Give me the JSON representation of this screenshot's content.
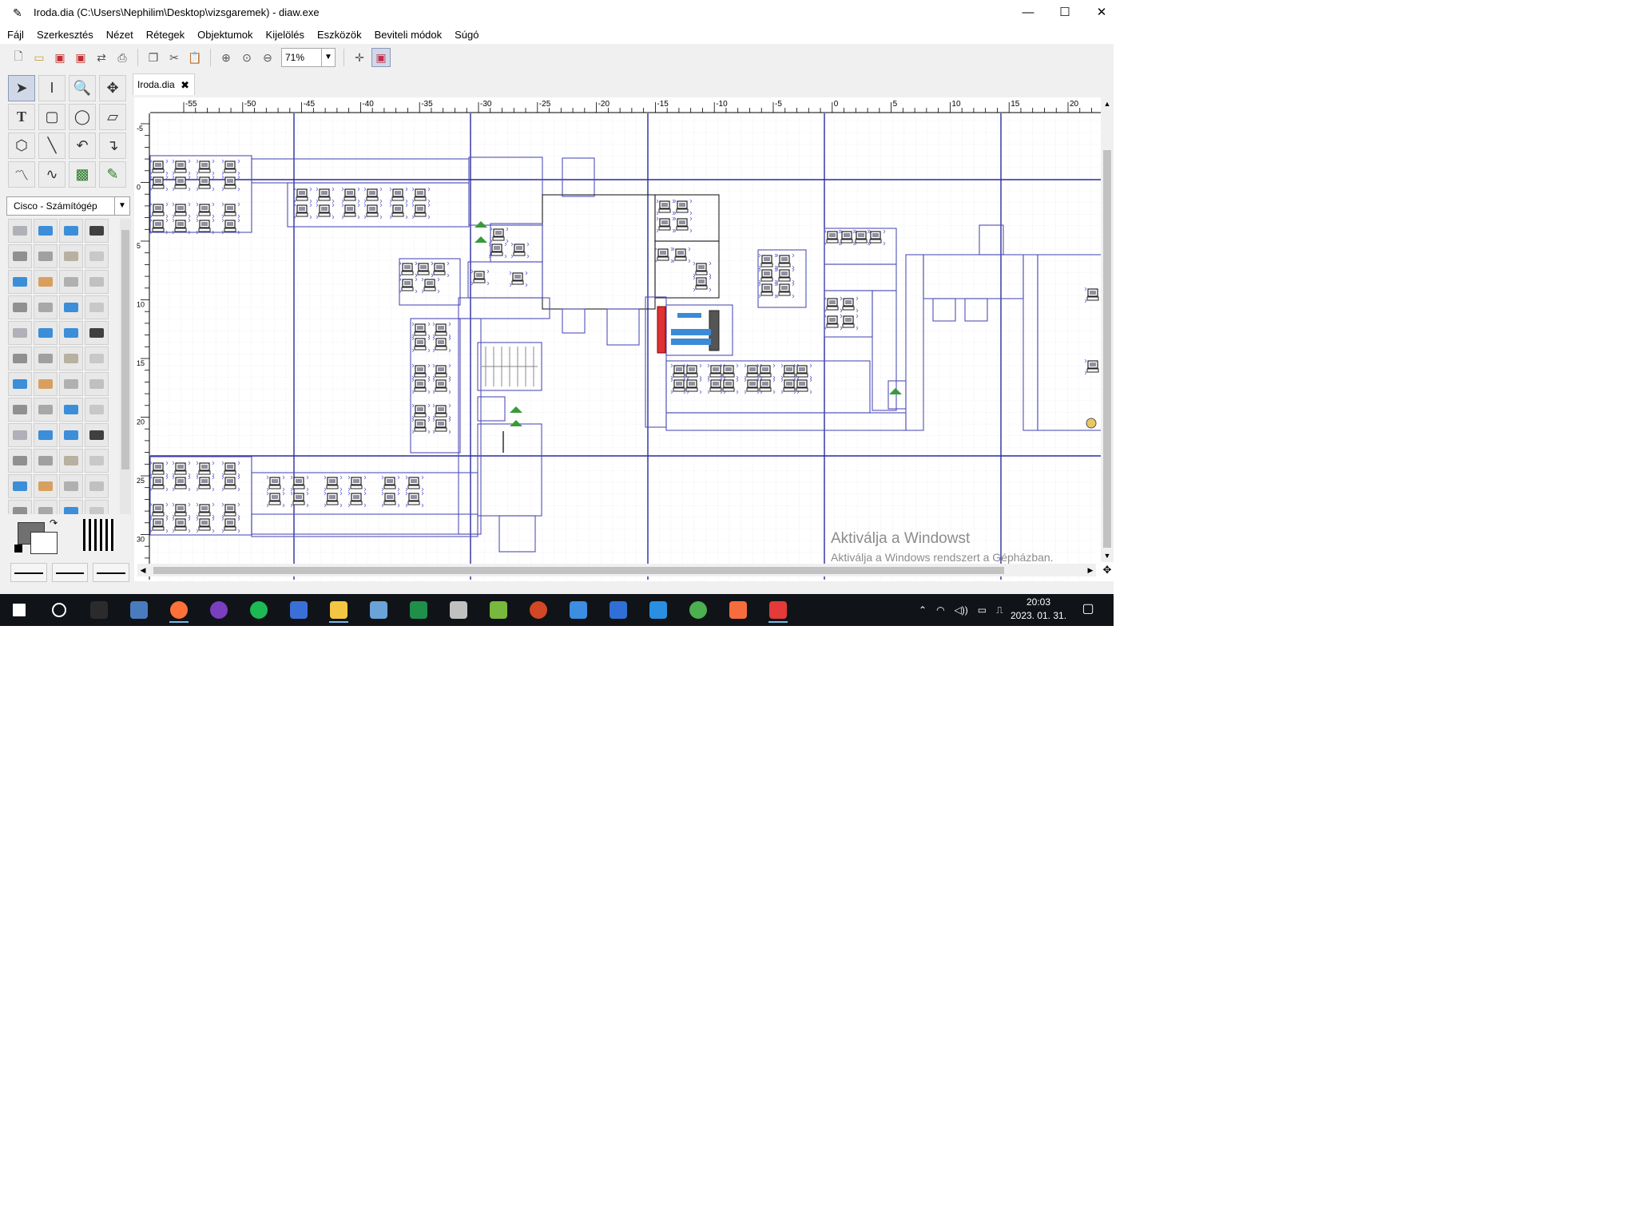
{
  "window": {
    "title": "Iroda.dia (C:\\Users\\Nephilim\\Desktop\\vizsgaremek) - diaw.exe",
    "minimize": "—",
    "maximize": "☐",
    "close": "✕"
  },
  "menu": [
    "Fájl",
    "Szerkesztés",
    "Nézet",
    "Rétegek",
    "Objektumok",
    "Kijelölés",
    "Eszközök",
    "Beviteli módok",
    "Súgó"
  ],
  "toolbar": {
    "zoom_value": "71%",
    "icons": [
      "new-icon",
      "open-icon",
      "save-icon",
      "save-as-icon",
      "export-icon",
      "print-icon",
      "copy-icon",
      "cut-icon",
      "paste-icon",
      "zoom-in-icon",
      "zoom-fit-icon",
      "zoom-out-icon"
    ]
  },
  "toolbox": {
    "sheet_name": "Cisco - Számítógép"
  },
  "document": {
    "tab_label": "Iroda.dia",
    "tab_close": "✖"
  },
  "rulers": {
    "horizontal": [
      "-55",
      "-50",
      "-45",
      "-40",
      "-35",
      "-30",
      "-25",
      "-20",
      "-15",
      "-10",
      "-5",
      "0",
      "5",
      "10",
      "15",
      "20"
    ],
    "vertical": [
      "-5",
      "0",
      "5",
      "10",
      "15",
      "20",
      "25",
      "30"
    ]
  },
  "watermark": {
    "line1": "Aktiválja a Windowst",
    "line2": "Aktiválja a Windows rendszert a Gépházban."
  },
  "taskbar": {
    "clock_time": "20:03",
    "clock_date": "2023. 01. 31.",
    "apps": [
      "start-icon",
      "search-icon",
      "terminal-icon",
      "calculator-icon",
      "firefox-icon",
      "tor-icon",
      "spotify-icon",
      "save-disk-icon",
      "file-explorer-icon",
      "paint-icon",
      "excel-icon",
      "pen-icon",
      "utorrent-icon",
      "powerpoint-icon",
      "edge-icon",
      "shark-icon",
      "vscode-icon",
      "chrome-icon",
      "xampp-icon",
      "dia-icon"
    ],
    "colors": [
      "#ffffff",
      "#ffffff",
      "#2b2b2b",
      "#4a7bbf",
      "#ff7139",
      "#7a3fbf",
      "#1db954",
      "#3a6fd8",
      "#f4c542",
      "#6aa3d8",
      "#1f8f4a",
      "#c0c0c0",
      "#78b83c",
      "#d24726",
      "#3d8de0",
      "#2f6fd6",
      "#2a8fe0",
      "#4caf50",
      "#f76c3c",
      "#e43a3a"
    ]
  }
}
